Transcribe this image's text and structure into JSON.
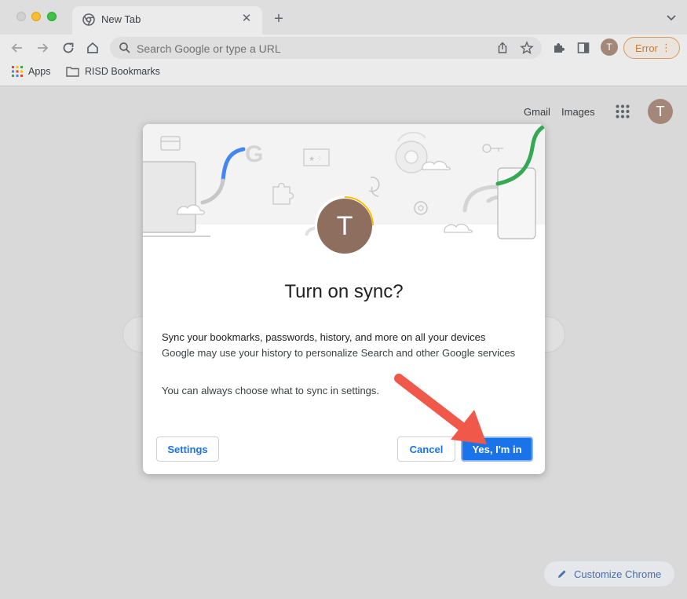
{
  "tab": {
    "title": "New Tab",
    "close": "✕",
    "new_tab": "+"
  },
  "toolbar": {
    "omnibox_placeholder": "Search Google or type a URL",
    "profile_initial": "T",
    "error_label": "Error",
    "error_menu": "⋮"
  },
  "bookmarks": [
    {
      "label": "Apps",
      "icon": "apps-grid-icon"
    },
    {
      "label": "RISD Bookmarks",
      "icon": "folder-icon"
    }
  ],
  "page": {
    "gmail": "Gmail",
    "images": "Images",
    "profile_initial": "T",
    "customize_label": "Customize Chrome"
  },
  "dialog": {
    "avatar_initial": "T",
    "title": "Turn on sync?",
    "line1": "Sync your bookmarks, passwords, history, and more on all your devices",
    "line2": "Google may use your history to personalize Search and other Google services",
    "line3": "You can always choose what to sync in settings.",
    "settings_button": "Settings",
    "cancel_button": "Cancel",
    "confirm_button": "Yes, I'm in"
  },
  "colors": {
    "accent": "#1a73e8",
    "annotation_arrow": "#f0584a",
    "error": "#c77b35"
  }
}
